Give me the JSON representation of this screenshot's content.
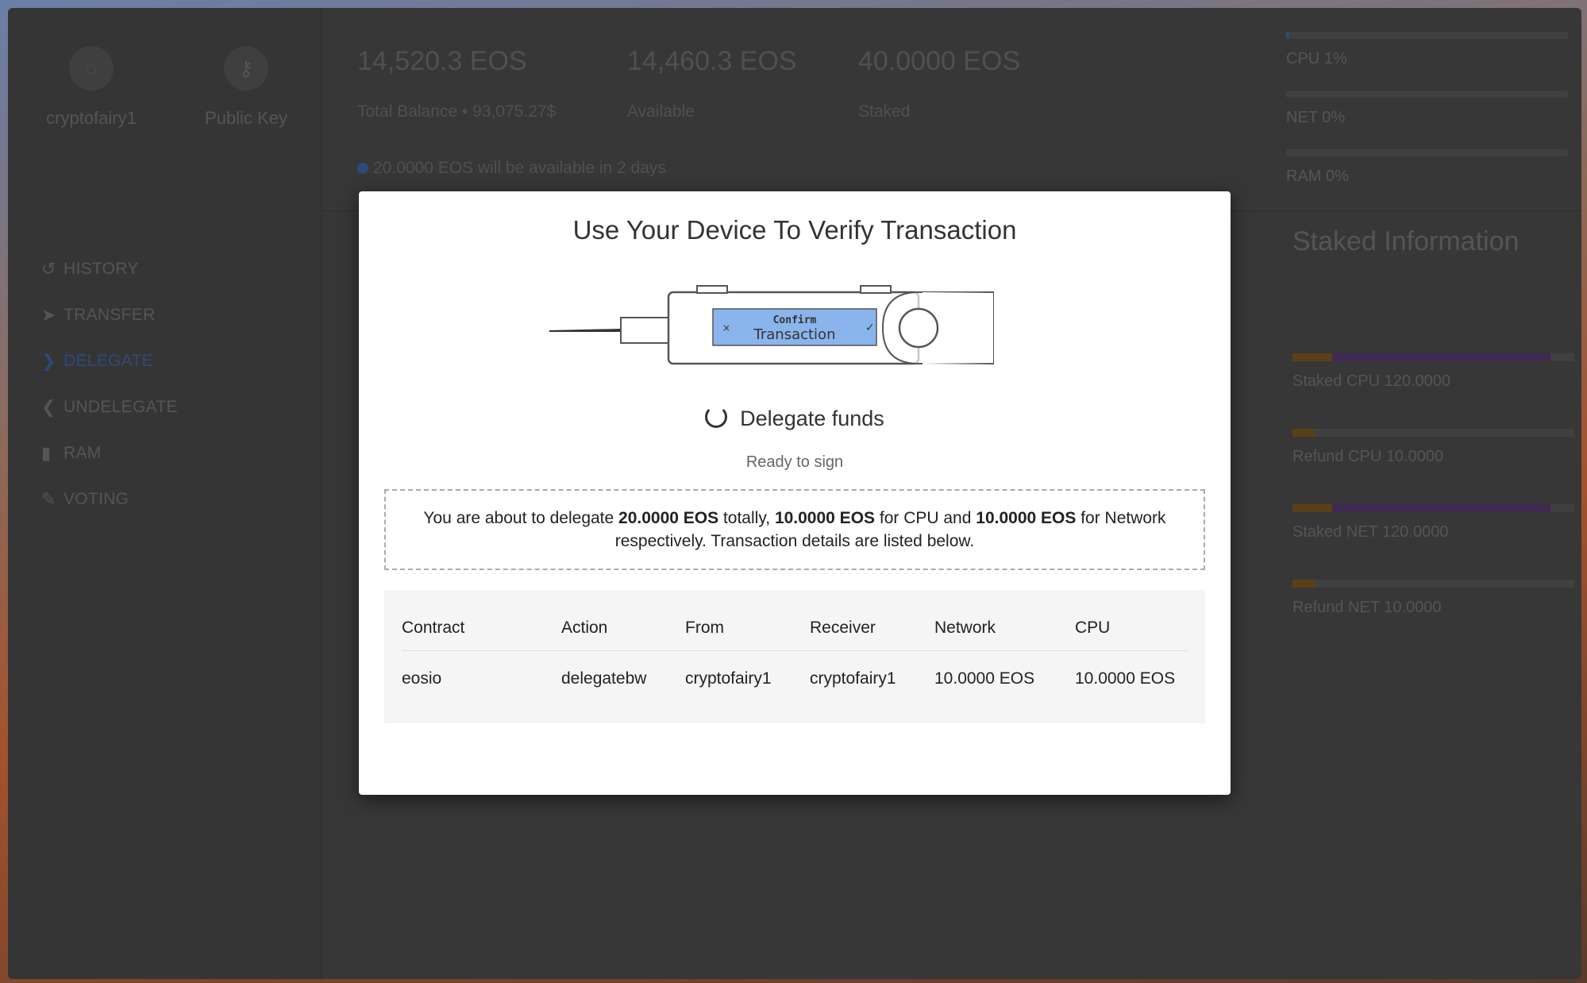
{
  "account": {
    "name": "cryptofairy1",
    "public_key_label": "Public Key"
  },
  "nav": {
    "items": [
      {
        "label": "HISTORY",
        "icon": "history-icon"
      },
      {
        "label": "TRANSFER",
        "icon": "paper-plane-icon"
      },
      {
        "label": "DELEGATE",
        "icon": "chevron-right-circle-icon"
      },
      {
        "label": "UNDELEGATE",
        "icon": "chevron-left-circle-icon"
      },
      {
        "label": "RAM",
        "icon": "memory-icon"
      },
      {
        "label": "VOTING",
        "icon": "edit-icon"
      }
    ],
    "active": "DELEGATE"
  },
  "stats": {
    "total_value": "14,520.3 EOS",
    "total_label": "Total Balance • 93,075.27$",
    "available_value": "14,460.3 EOS",
    "available_label": "Available",
    "staked_value": "40.0000 EOS",
    "staked_label": "Staked",
    "notice": "20.0000 EOS will be available in 2 days"
  },
  "resources": [
    {
      "label": "CPU 1%",
      "percent": 1
    },
    {
      "label": "NET 0%",
      "percent": 0
    },
    {
      "label": "RAM 0%",
      "percent": 0
    }
  ],
  "staked_info": {
    "title": "Staked Information",
    "rows": [
      {
        "label": "Staked CPU 120.0000"
      },
      {
        "label": "Refund CPU 10.0000"
      },
      {
        "label": "Staked NET 120.0000"
      },
      {
        "label": "Refund NET 10.0000"
      }
    ]
  },
  "modal": {
    "title": "Use Your Device To Verify Transaction",
    "device_line1": "Confirm",
    "device_line2": "Transaction",
    "action_title": "Delegate funds",
    "status": "Ready to sign",
    "summary": {
      "p1": "You are about to delegate ",
      "total": "20.0000 EOS",
      "p2": " totally, ",
      "cpu": "10.0000 EOS",
      "p3": " for CPU and ",
      "net": "10.0000 EOS",
      "p4": " for Network respectively. Transaction details are listed below."
    },
    "table": {
      "headers": [
        "Contract",
        "Action",
        "From",
        "Receiver",
        "Network",
        "CPU"
      ],
      "row": [
        "eosio",
        "delegatebw",
        "cryptofairy1",
        "cryptofairy1",
        "10.0000 EOS",
        "10.0000 EOS"
      ]
    }
  }
}
